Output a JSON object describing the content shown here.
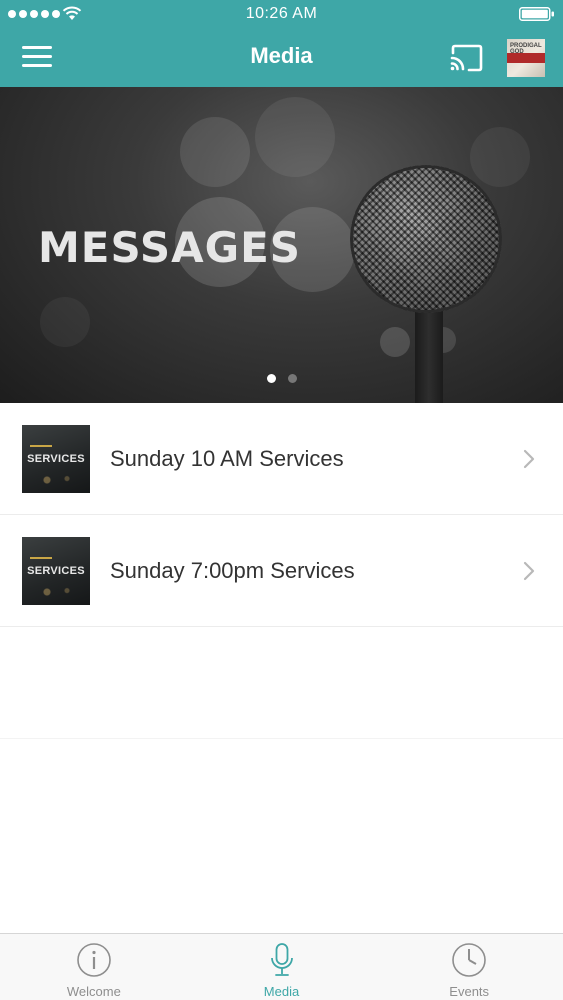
{
  "status_bar": {
    "time": "10:26 AM"
  },
  "nav": {
    "title": "Media",
    "avatar_text": "PRODIGAL GOD"
  },
  "banner": {
    "title": "MESSAGES",
    "slides_total": 2,
    "active_slide": 1
  },
  "list": {
    "items": [
      {
        "label": "Sunday 10 AM Services",
        "thumb_text": "SERVICES"
      },
      {
        "label": "Sunday 7:00pm Services",
        "thumb_text": "SERVICES"
      }
    ]
  },
  "tabs": [
    {
      "label": "Welcome",
      "icon": "info-icon",
      "active": false
    },
    {
      "label": "Media",
      "icon": "microphone-icon",
      "active": true
    },
    {
      "label": "Events",
      "icon": "clock-icon",
      "active": false
    }
  ],
  "colors": {
    "accent": "#3ea7a7",
    "tab_inactive": "#8e8e8e"
  }
}
